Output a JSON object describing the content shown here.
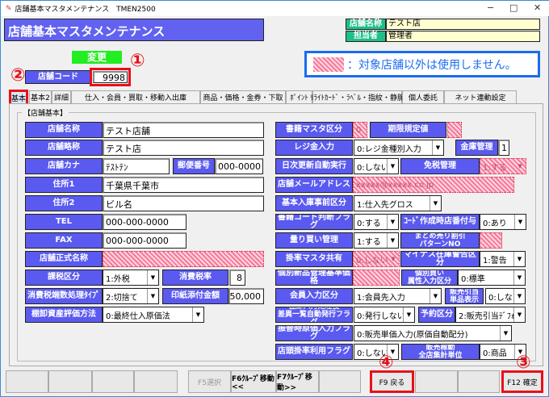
{
  "window": {
    "title": "店舗基本マスタメンテナンス　TMEN2500",
    "minimize": "−",
    "maximize": "□",
    "close": "✕"
  },
  "header": {
    "title": "店舗基本マスタメンテナンス",
    "store_name_label": "店舗名称",
    "store_name": "テスト店",
    "staff_label": "担当者",
    "staff": "管理者"
  },
  "mode_badge": "変更",
  "store_code_label": "店舗コード",
  "store_code": "9998",
  "notice": "：対象店舗以外は使用しません。",
  "annotations": [
    "①",
    "②",
    "③",
    "④"
  ],
  "tabs": [
    "基本",
    "基本2",
    "詳細",
    "仕入・会員・買取・移動入出庫",
    "商品・価格・金券・下取",
    "ﾎﾟｲﾝﾄ",
    "ﾘﾗｲﾄｶｰﾄﾞ・ﾗﾍﾞﾙ・指紋・静脈",
    "個人委託",
    "ネット連動設定"
  ],
  "active_tab": "基本",
  "group_title": "【店舗基本】",
  "form": {
    "l_name": "店舗名称",
    "v_name": "テスト店舗",
    "l_short": "店舗略称",
    "v_short": "テスト店",
    "l_kana": "店舗カナ",
    "v_kana": "ﾃｽﾄﾃﾝ",
    "l_zip": "郵便番号",
    "v_zip": "000-0000",
    "l_addr1": "住所1",
    "v_addr1": "千葉県千葉市",
    "l_addr2": "住所2",
    "v_addr2": "ビル名",
    "l_tel": "TEL",
    "v_tel": "000-000-0000",
    "l_fax": "FAX",
    "v_fax": "000-000-0000",
    "l_formal": "店舗正式名称",
    "v_formal": "",
    "l_taxkbn": "課税区分",
    "v_taxkbn": "1:外税",
    "l_taxrate": "消費税率",
    "v_taxrate": "8",
    "l_round": "消費税端数処理ﾀｲﾌﾟ",
    "v_round": "2:切捨て",
    "l_stamp": "印紙添付金額",
    "v_stamp": "50,000",
    "l_inv": "棚卸資産評価方法",
    "v_inv": "0:最終仕入原価法",
    "l_book": "書籍マスタ区分",
    "v_book": "0",
    "l_limit": "期限規定値",
    "v_limit": "",
    "l_reg": "レジ金入力",
    "v_reg": "0:レジ金種別入力",
    "l_safe": "金庫管理",
    "v_safe": "1",
    "l_daily": "日次更新自動実行",
    "v_daily": "0:しない",
    "l_dutyfree": "免税管理",
    "v_dutyfree": "1:する",
    "l_mail": "店舗メールアドレス",
    "v_mail": "xxxxx@xxxxx.co.jp",
    "l_stock": "基本入庫事前区分",
    "v_stock": "1:仕入先グロス",
    "l_bookcode": "書籍コード判断フラグ",
    "v_bookcode": "0:する",
    "l_codegen": "ｺｰﾄﾞ作成時店番付与",
    "v_codegen": "0:あり",
    "l_weigh": "量り買い管理",
    "v_weigh": "1:する",
    "l_bundle": "まとめ売り割引\nパターンNO",
    "v_bundle": "",
    "l_rate": "掛率マスタ共有",
    "v_rate": "0:しない",
    "l_minus": "マイナス在庫警告区分",
    "v_minus": "1:警告",
    "l_indiv": "個別新品管理基準価格",
    "v_indiv": "",
    "l_indivbuy": "個別買い\n属性入力区分",
    "v_indivbuy": "0:標準",
    "l_member": "会員入力区分",
    "v_member": "1:会員先入力",
    "l_alloc": "販売引当\n単品表示",
    "v_alloc": "0:しない",
    "l_invproc": "棚卸入力処理後\n差異一覧自動発行フラグ",
    "v_invproc": "0:発行しない",
    "l_reserve": "予約区分",
    "v_reserve": "2:販売引当ﾃﾞﾌｫﾙﾄ",
    "l_transfer": "振替時原価入力フラグ",
    "v_transfer": "0:販売単価入力(原価自動配分)",
    "l_shoprate": "店頭掛率利用フラグ",
    "v_shoprate": "0:しない",
    "l_sales": "販売稼動\n全店集計単位",
    "v_sales": "0:商品"
  },
  "footer": [
    "",
    "",
    "",
    "",
    "F5選択",
    "F6ｸﾙｰﾌﾟ移動<<",
    "F7ｸﾙｰﾌﾟ移動>>",
    "",
    "F9 戻る",
    "",
    "",
    "F12 確定"
  ],
  "colors": {
    "label_bg": "#5a5af0",
    "header_bg": "#6262f0",
    "accent_green": "#1fbf8a",
    "mode_green": "#22ee22",
    "highlight_red": "#e8101a",
    "hatch_pink": "#f47a9a"
  }
}
